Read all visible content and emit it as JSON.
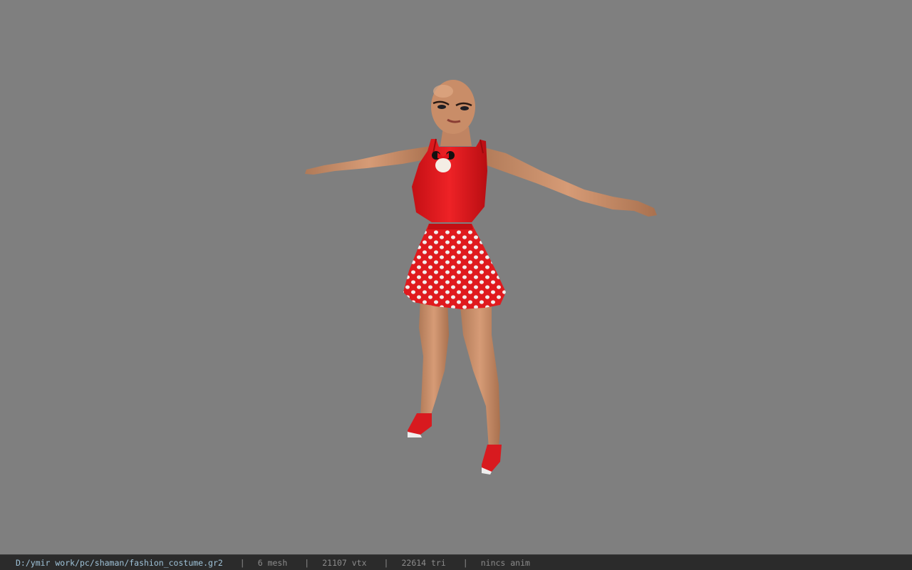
{
  "viewport": {
    "background": "#7f7f7f",
    "model": "character-model",
    "outfit_colors": {
      "top": "#e1141a",
      "skirt": "#e1141a",
      "dots": "#f4f0f0",
      "skin": "#c8906b",
      "shoes": "#d81a1f"
    }
  },
  "statusbar": {
    "file_path": "D:/ymir work/pc/shaman/fashion_costume.gr2",
    "separator": "|",
    "mesh_count": "6 mesh",
    "vertex_count": "21107 vtx",
    "triangle_count": "22614 tri",
    "anim_status": "nincs anim"
  }
}
